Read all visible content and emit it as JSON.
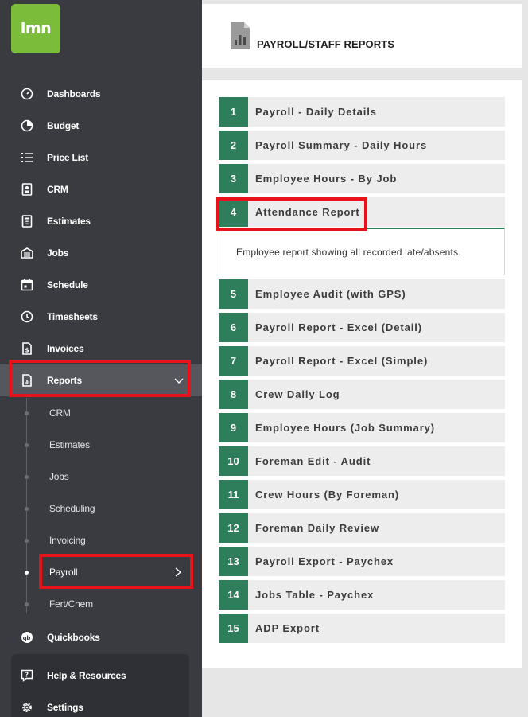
{
  "logo": {
    "text": "lmn"
  },
  "sidebar": {
    "items": [
      {
        "label": "Dashboards"
      },
      {
        "label": "Budget"
      },
      {
        "label": "Price List"
      },
      {
        "label": "CRM"
      },
      {
        "label": "Estimates"
      },
      {
        "label": "Jobs"
      },
      {
        "label": "Schedule"
      },
      {
        "label": "Timesheets"
      },
      {
        "label": "Invoices"
      },
      {
        "label": "Reports"
      }
    ],
    "sub_items": [
      {
        "label": "CRM"
      },
      {
        "label": "Estimates"
      },
      {
        "label": "Jobs"
      },
      {
        "label": "Scheduling"
      },
      {
        "label": "Invoicing"
      },
      {
        "label": "Payroll"
      },
      {
        "label": "Fert/Chem"
      }
    ],
    "quickbooks": {
      "label": "Quickbooks"
    },
    "help": {
      "label": "Help & Resources"
    },
    "settings": {
      "label": "Settings"
    }
  },
  "header": {
    "title": "PAYROLL/STAFF REPORTS"
  },
  "reports": [
    {
      "num": "1",
      "label": "Payroll - Daily Details"
    },
    {
      "num": "2",
      "label": "Payroll Summary - Daily Hours"
    },
    {
      "num": "3",
      "label": "Employee Hours - By Job"
    },
    {
      "num": "4",
      "label": "Attendance Report"
    },
    {
      "num": "5",
      "label": "Employee Audit (with GPS)"
    },
    {
      "num": "6",
      "label": "Payroll Report - Excel (Detail)"
    },
    {
      "num": "7",
      "label": "Payroll Report - Excel (Simple)"
    },
    {
      "num": "8",
      "label": "Crew Daily Log"
    },
    {
      "num": "9",
      "label": "Employee Hours (Job Summary)"
    },
    {
      "num": "10",
      "label": "Foreman Edit - Audit"
    },
    {
      "num": "11",
      "label": "Crew Hours (By Foreman)"
    },
    {
      "num": "12",
      "label": "Foreman Daily Review"
    },
    {
      "num": "13",
      "label": "Payroll Export - Paychex"
    },
    {
      "num": "14",
      "label": "Jobs Table - Paychex"
    },
    {
      "num": "15",
      "label": "ADP Export"
    }
  ],
  "expanded_description": "Employee report showing all recorded late/absents.",
  "colors": {
    "accent": "#2e7d5b",
    "highlight": "#e8121a",
    "brand": "#7bbd3a"
  }
}
